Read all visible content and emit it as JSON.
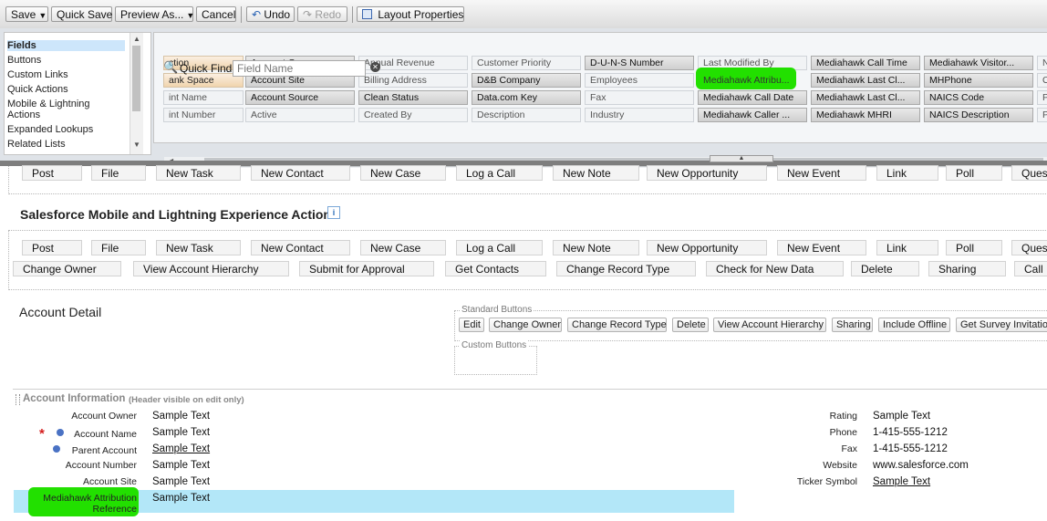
{
  "toolbar": {
    "save": "Save",
    "quick_save": "Quick Save",
    "preview_as": "Preview As...",
    "cancel": "Cancel",
    "undo": "Undo",
    "redo": "Redo",
    "layout_properties": "Layout Properties"
  },
  "palette": {
    "categories": [
      "Fields",
      "Buttons",
      "Custom Links",
      "Quick Actions",
      "Mobile & Lightning",
      "Actions",
      "Expanded Lookups",
      "Related Lists"
    ],
    "selected_category": "Fields",
    "quick_find_label": "Quick Find",
    "quick_find_placeholder": "Field Name",
    "fields": [
      [
        "ction",
        "Account Owner",
        "Annual Revenue",
        "Customer Priority",
        "D-U-N-S Number",
        "Last Modified By",
        "Mediahawk Call Time",
        "Mediahawk Visitor...",
        "N"
      ],
      [
        "ank Space",
        "Account Site",
        "Billing Address",
        "D&B Company",
        "Employees",
        "Mediahawk Attribu...",
        "Mediahawk Last Cl...",
        "MHPhone",
        "O"
      ],
      [
        "int Name",
        "Account Source",
        "Clean Status",
        "Data.com Key",
        "Fax",
        "Mediahawk Call Date",
        "Mediahawk Last Cl...",
        "NAICS Code",
        "P"
      ],
      [
        "int Number",
        "Active",
        "Created By",
        "Description",
        "Industry",
        "Mediahawk Caller ...",
        "Mediahawk MHRI",
        "NAICS Description",
        "P"
      ]
    ]
  },
  "quick_actions": {
    "row1": [
      "Post",
      "File",
      "New Task",
      "New Contact",
      "New Case",
      "Log a Call",
      "New Note",
      "New Opportunity",
      "New Event",
      "Link",
      "Poll",
      "Ques"
    ]
  },
  "mobile_section": {
    "title": "Salesforce Mobile and Lightning Experience Actions",
    "info_icon": "i",
    "row1": [
      "Post",
      "File",
      "New Task",
      "New Contact",
      "New Case",
      "Log a Call",
      "New Note",
      "New Opportunity",
      "New Event",
      "Link",
      "Poll",
      "Ques"
    ],
    "row2": [
      "Change Owner",
      "View Account Hierarchy",
      "Submit for Approval",
      "Get Contacts",
      "Change Record Type",
      "Check for New Data",
      "Delete",
      "Sharing",
      "Call"
    ]
  },
  "account_detail": {
    "title": "Account Detail",
    "standard_buttons_legend": "Standard Buttons",
    "standard_buttons": [
      "Edit",
      "Change Owner",
      "Change Record Type",
      "Delete",
      "View Account Hierarchy",
      "Sharing",
      "Include Offline",
      "Get Survey Invitatio"
    ],
    "custom_buttons_legend": "Custom Buttons"
  },
  "account_info": {
    "title": "Account Information",
    "subtitle": "(Header visible on edit only)",
    "left_fields": [
      {
        "label": "Account Owner",
        "value": "Sample Text"
      },
      {
        "label": "Account Name",
        "value": "Sample Text"
      },
      {
        "label": "Parent Account",
        "value": "Sample Text"
      },
      {
        "label": "Account Number",
        "value": "Sample Text"
      },
      {
        "label": "Account Site",
        "value": "Sample Text"
      },
      {
        "label": "Mediahawk Attribution",
        "label2": "Reference",
        "value": "Sample Text"
      }
    ],
    "right_fields": [
      {
        "label": "Rating",
        "value": "Sample Text"
      },
      {
        "label": "Phone",
        "value": "1-415-555-1212"
      },
      {
        "label": "Fax",
        "value": "1-415-555-1212"
      },
      {
        "label": "Website",
        "value": "www.salesforce.com"
      },
      {
        "label": "Ticker Symbol",
        "value": "Sample Text"
      }
    ]
  },
  "colors": {
    "highlight_row": "#b3e7f8",
    "green_marker": "#22e000",
    "required": "#d41c1c"
  }
}
